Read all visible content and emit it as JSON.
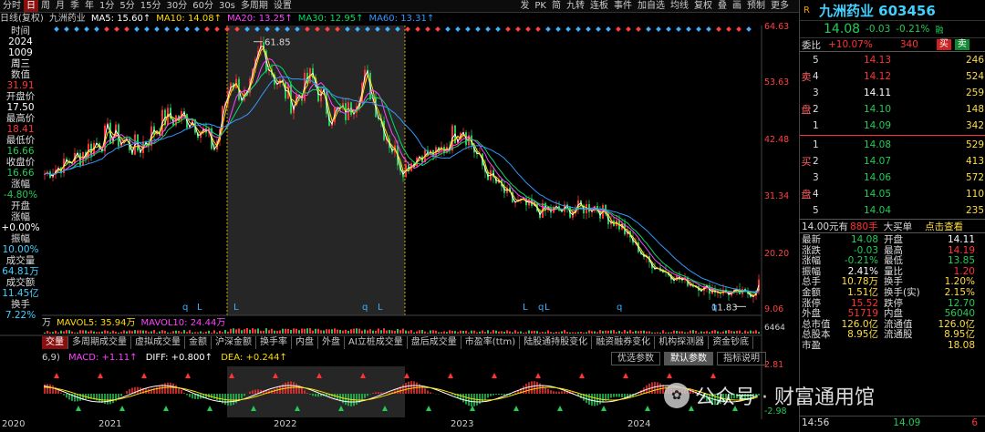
{
  "toolbar": {
    "left": [
      "分时",
      "日",
      "周",
      "月",
      "季",
      "年",
      "1分",
      "5分",
      "15分",
      "30分",
      "60分",
      "30s",
      "多周期",
      "设置"
    ],
    "selected": "日",
    "right": [
      "发",
      "PK",
      "简",
      "九转",
      "连板",
      "事件",
      "加自选",
      "均线",
      "复权",
      "叠",
      "画",
      "预制",
      "更多"
    ]
  },
  "ma_bar": {
    "label": "日线(复权)",
    "name": "九洲药业",
    "ma5": "MA5: 15.60↑",
    "ma10": "MA10: 14.08↑",
    "ma20": "MA20: 13.25↑",
    "ma30": "MA30: 12.95↑",
    "ma60": "MA60: 13.31↑"
  },
  "left_info": [
    {
      "t": "时间",
      "c": "k"
    },
    {
      "t": "2024",
      "c": "v"
    },
    {
      "t": "1009",
      "c": "v"
    },
    {
      "t": "周三",
      "c": "v"
    },
    {
      "t": "数值",
      "c": "k"
    },
    {
      "t": "31.91",
      "c": "r"
    },
    {
      "t": "开盘价",
      "c": "k"
    },
    {
      "t": "17.50",
      "c": "v"
    },
    {
      "t": "最高价",
      "c": "k"
    },
    {
      "t": "18.41",
      "c": "r"
    },
    {
      "t": "最低价",
      "c": "k"
    },
    {
      "t": "16.66",
      "c": "g"
    },
    {
      "t": "收盘价",
      "c": "k"
    },
    {
      "t": "16.66",
      "c": "g"
    },
    {
      "t": "涨幅",
      "c": "k"
    },
    {
      "t": "-4.80%",
      "c": "g"
    },
    {
      "t": "开盘",
      "c": "k"
    },
    {
      "t": "涨幅",
      "c": "k"
    },
    {
      "t": "+0.00%",
      "c": "v"
    },
    {
      "t": "振幅",
      "c": "k"
    },
    {
      "t": "10.00%",
      "c": "c"
    },
    {
      "t": "成交量",
      "c": "k"
    },
    {
      "t": "64.81万",
      "c": "c"
    },
    {
      "t": "成交额",
      "c": "k"
    },
    {
      "t": "11.45亿",
      "c": "c"
    },
    {
      "t": "换手",
      "c": "k"
    },
    {
      "t": "7.22%",
      "c": "c"
    }
  ],
  "price_axis": [
    "64.63",
    "53.63",
    "42.48",
    "31.34",
    "20.20",
    "9.06"
  ],
  "peak_label": "61.85",
  "low_label": "11.83",
  "volume_bar": {
    "unit": "万",
    "mavol5": "MAVOL5: 35.94万",
    "mavol10": "MAVOL10: 24.44万",
    "axis": "6464"
  },
  "indicator_tabs": [
    "交量",
    "多周期成交量",
    "虚拟成交量",
    "金额",
    "沪深金额",
    "换手率",
    "内盘",
    "外盘",
    "AI立桩成交量",
    "盘后成交量",
    "市盈率(ttm)",
    "陆股通持股变化",
    "融资融券变化",
    "机构探测器",
    "资金钞底"
  ],
  "indicator_tab_active": "交量",
  "macd": {
    "label": "6,9)",
    "macd": "MACD: +1.11↑",
    "diff": "DIFF: +0.800↑",
    "dea": "DEA: +0.244↑",
    "axis_top": "2.81",
    "axis_bottom": "-2.98"
  },
  "sub_tabs": [
    "优选参数",
    "默认参数",
    "指标说明"
  ],
  "sub_tab_active": "默认参数",
  "years": [
    "2020",
    "2021",
    "2022",
    "2023",
    "2024"
  ],
  "quote": {
    "tag": "R",
    "name": "九洲药业 603456",
    "price": "14.08",
    "change": "-0.03",
    "pct": "-0.21%",
    "flag": "融",
    "wb_label": "委比",
    "wb_val": "+10.07%",
    "wb_diff": "340",
    "buy_btn": "买",
    "sell_btn": "卖",
    "sell_side": "卖盘",
    "buy_side": "买盘",
    "asks": [
      {
        "n": "5",
        "p": "14.13",
        "v": "246"
      },
      {
        "n": "4",
        "p": "14.12",
        "v": "524"
      },
      {
        "n": "3",
        "p": "14.11",
        "v": "259"
      },
      {
        "n": "2",
        "p": "14.10",
        "v": "148"
      },
      {
        "n": "1",
        "p": "14.09",
        "v": "342"
      }
    ],
    "bids": [
      {
        "n": "1",
        "p": "14.08",
        "v": "529"
      },
      {
        "n": "2",
        "p": "14.07",
        "v": "413"
      },
      {
        "n": "3",
        "p": "14.06",
        "v": "572"
      },
      {
        "n": "4",
        "p": "14.05",
        "v": "110"
      },
      {
        "n": "5",
        "p": "14.04",
        "v": "235"
      }
    ],
    "big_order": "14.00元有",
    "big_val": "880手",
    "big_label": "大买单",
    "big_link": "点击查看",
    "stats": [
      {
        "k1": "最新",
        "v1": "14.08",
        "c1": "g",
        "k2": "开盘",
        "v2": "14.11",
        "c2": "w"
      },
      {
        "k1": "涨跌",
        "v1": "-0.03",
        "c1": "g",
        "k2": "最高",
        "v2": "14.19",
        "c2": "r"
      },
      {
        "k1": "涨幅",
        "v1": "-0.21%",
        "c1": "g",
        "k2": "最低",
        "v2": "13.85",
        "c2": "g"
      },
      {
        "k1": "振幅",
        "v1": "2.41%",
        "c1": "w",
        "k2": "量比",
        "v2": "1.20",
        "c2": "r"
      },
      {
        "k1": "总手",
        "v1": "10.78万",
        "c1": "y",
        "k2": "换手",
        "v2": "1.20%",
        "c2": "y"
      },
      {
        "k1": "金额",
        "v1": "1.51亿",
        "c1": "y",
        "k2": "换手(实)",
        "v2": "2.15%",
        "c2": "y"
      },
      {
        "k1": "涨停",
        "v1": "15.52",
        "c1": "r",
        "k2": "跌停",
        "v2": "12.70",
        "c2": "g"
      },
      {
        "k1": "外盘",
        "v1": "51719",
        "c1": "r",
        "k2": "内盘",
        "v2": "56040",
        "c2": "g"
      },
      {
        "k1": "总市值",
        "v1": "126.0亿",
        "c1": "y",
        "k2": "流通值",
        "v2": "126.0亿",
        "c2": "y"
      },
      {
        "k1": "总股本",
        "v1": "8.95亿",
        "c1": "y",
        "k2": "流通股",
        "v2": "8.95亿",
        "c2": "y"
      },
      {
        "k1": "市盈",
        "v1": "",
        "c1": "y",
        "k2": "",
        "v2": "18.08",
        "c2": "y"
      }
    ],
    "tick": {
      "time": "14:56",
      "price": "14.09",
      "vol": "6"
    }
  },
  "watermark": "公众号 · 财富通用馆",
  "colors": {
    "up": "#ff3333",
    "down": "#22cc55",
    "ma5": "#ffffff",
    "ma10": "#ffdd00",
    "ma20": "#ff44ff",
    "ma30": "#00dd66",
    "ma60": "#3399ff",
    "accent": "#8a1010"
  }
}
